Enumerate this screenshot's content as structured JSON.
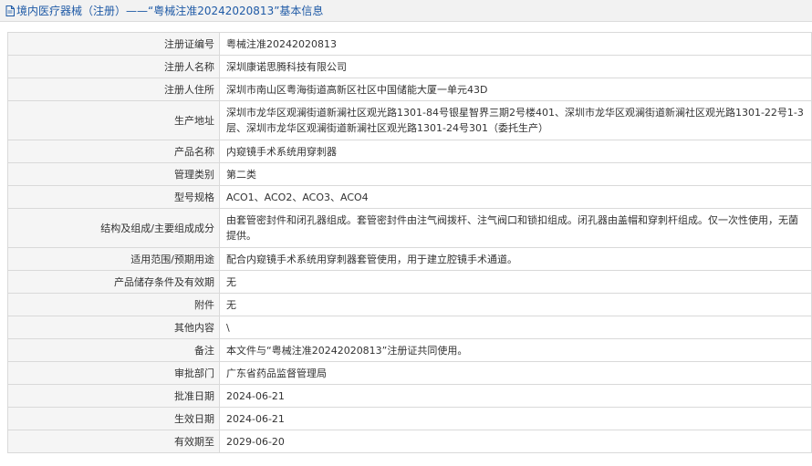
{
  "header": {
    "icon": "document-icon",
    "title": "境内医疗器械（注册）——“粤械注准20242020813”基本信息"
  },
  "rows": [
    {
      "label": "注册证编号",
      "value": "粤械注准20242020813"
    },
    {
      "label": "注册人名称",
      "value": "深圳康诺思腾科技有限公司"
    },
    {
      "label": "注册人住所",
      "value": "深圳市南山区粤海街道高新区社区中国储能大厦一单元43D"
    },
    {
      "label": "生产地址",
      "value": "深圳市龙华区观澜街道新澜社区观光路1301-84号银星智界三期2号楼401、深圳市龙华区观澜街道新澜社区观光路1301-22号1-3层、深圳市龙华区观澜街道新澜社区观光路1301-24号301（委托生产）"
    },
    {
      "label": "产品名称",
      "value": "内窥镜手术系统用穿刺器"
    },
    {
      "label": "管理类别",
      "value": "第二类"
    },
    {
      "label": "型号规格",
      "value": "ACO1、ACO2、ACO3、ACO4"
    },
    {
      "label": "结构及组成/主要组成成分",
      "value": "由套管密封件和闭孔器组成。套管密封件由注气阀拨杆、注气阀口和锁扣组成。闭孔器由盖帽和穿刺杆组成。仅一次性使用，无菌提供。"
    },
    {
      "label": "适用范围/预期用途",
      "value": "配合内窥镜手术系统用穿刺器套管使用，用于建立腔镜手术通道。"
    },
    {
      "label": "产品储存条件及有效期",
      "value": "无"
    },
    {
      "label": "附件",
      "value": "无"
    },
    {
      "label": "其他内容",
      "value": "\\"
    },
    {
      "label": "备注",
      "value": "本文件与“粤械注准20242020813”注册证共同使用。"
    },
    {
      "label": "审批部门",
      "value": "广东省药品监督管理局"
    },
    {
      "label": "批准日期",
      "value": "2024-06-21"
    },
    {
      "label": "生效日期",
      "value": "2024-06-21"
    },
    {
      "label": "有效期至",
      "value": "2029-06-20"
    }
  ]
}
